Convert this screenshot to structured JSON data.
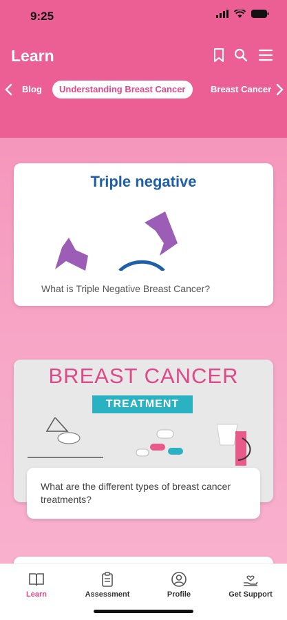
{
  "status": {
    "time": "9:25"
  },
  "header": {
    "title": "Learn"
  },
  "nav": {
    "items": [
      "Blog",
      "Understanding Breast Cancer",
      "Breast Cancer"
    ],
    "active_index": 1
  },
  "cards": [
    {
      "image_title": "Triple negative",
      "caption": "What is Triple Negative Breast Cancer?"
    },
    {
      "image_title": "BREAST CANCER",
      "image_ribbon": "TREATMENT",
      "caption": "What are the different types of breast cancer treatments?"
    }
  ],
  "tabbar": {
    "tabs": [
      {
        "label": "Learn",
        "icon": "book-icon",
        "active": true
      },
      {
        "label": "Assessment",
        "icon": "clipboard-icon",
        "active": false
      },
      {
        "label": "Profile",
        "icon": "user-icon",
        "active": false
      },
      {
        "label": "Get Support",
        "icon": "support-hand-icon",
        "active": false
      }
    ]
  },
  "colors": {
    "brand_pink": "#ec5f95",
    "active_pink": "#e0488a",
    "title_blue": "#1d5fa8",
    "teal": "#2bb2c2"
  }
}
